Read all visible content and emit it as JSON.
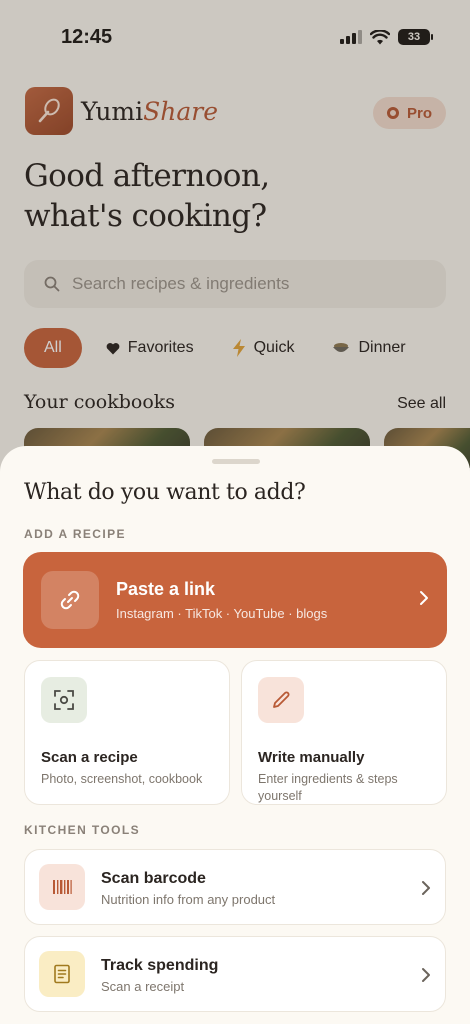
{
  "status_bar": {
    "time": "12:45",
    "battery": "33"
  },
  "header": {
    "brand_part1": "Yumi",
    "brand_part2": "Share",
    "pro_label": "Pro"
  },
  "greeting": {
    "line1": "Good afternoon,",
    "line2": "what's cooking?"
  },
  "search": {
    "placeholder": "Search recipes & ingredients"
  },
  "filters": [
    {
      "label": "All",
      "icon": "none",
      "active": true
    },
    {
      "label": "Favorites",
      "icon": "heart-icon"
    },
    {
      "label": "Quick",
      "icon": "lightning-icon"
    },
    {
      "label": "Dinner",
      "icon": "bowl-icon"
    }
  ],
  "cookbooks": {
    "title": "Your cookbooks",
    "see_all": "See all"
  },
  "sheet": {
    "title": "What do you want to add?",
    "add_section": "ADD A RECIPE",
    "paste": {
      "title": "Paste a link",
      "subtitle": "Instagram · TikTok · YouTube · blogs",
      "icon": "link-icon"
    },
    "scan": {
      "title": "Scan a recipe",
      "subtitle": "Photo, screenshot, cookbook",
      "icon": "scan-icon"
    },
    "write": {
      "title": "Write manually",
      "subtitle": "Enter ingredients & steps yourself",
      "icon": "pencil-icon"
    },
    "tools_section": "KITCHEN TOOLS",
    "barcode": {
      "title": "Scan barcode",
      "subtitle": "Nutrition info from any product",
      "icon": "barcode-icon"
    },
    "spending": {
      "title": "Track spending",
      "subtitle": "Scan a receipt",
      "icon": "receipt-icon"
    }
  },
  "colors": {
    "accent": "#c8643d",
    "background": "#faf6ef",
    "sheet": "#fcf9f3",
    "text": "#2b2521"
  }
}
